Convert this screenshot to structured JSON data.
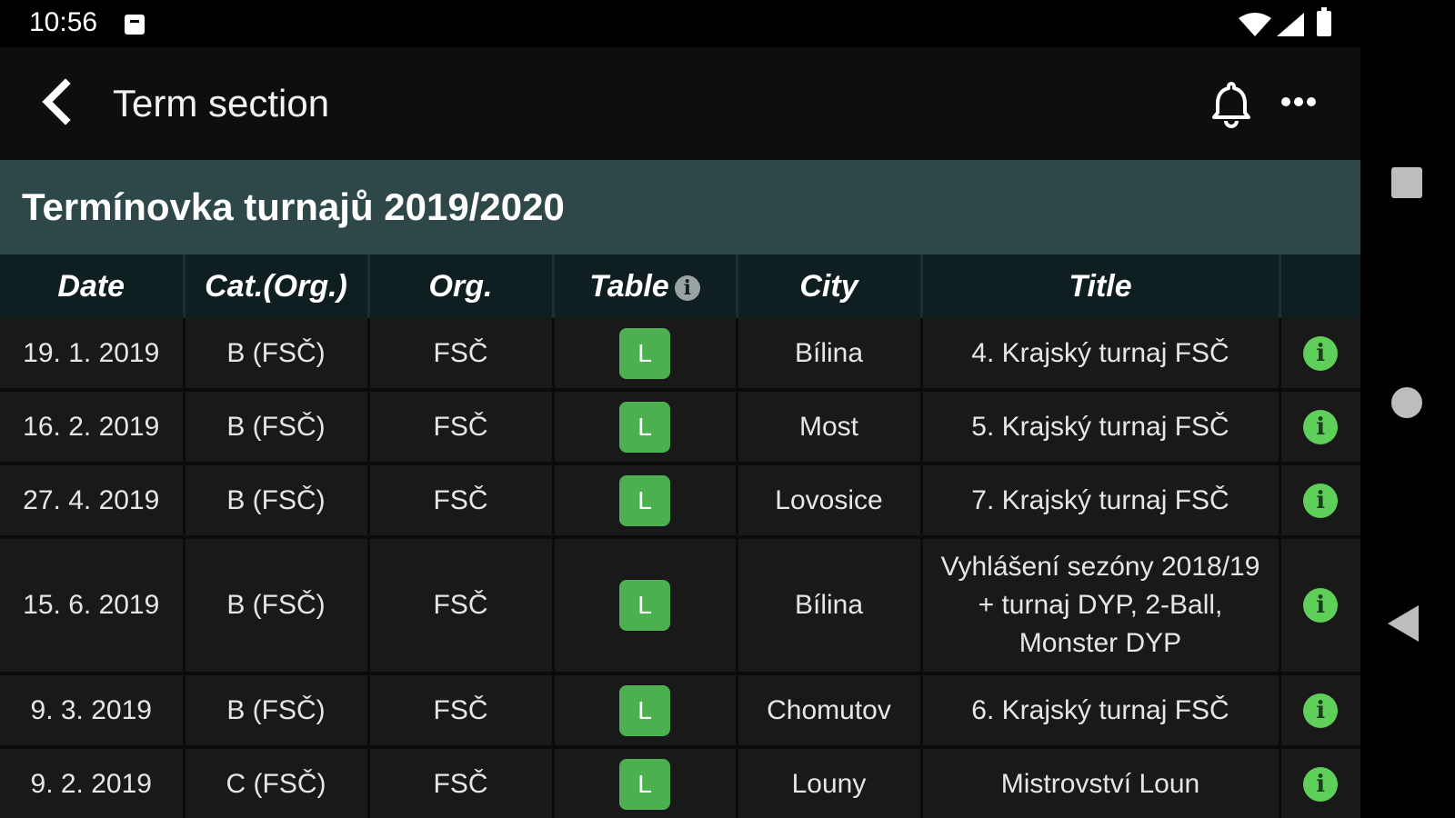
{
  "status_bar": {
    "time": "10:56",
    "icons": [
      "notification-a-icon",
      "wifi-icon",
      "signal-icon",
      "battery-icon"
    ]
  },
  "toolbar": {
    "back_icon": "chevron-left-icon",
    "title": "Term section",
    "bell_icon": "bell-icon",
    "more_icon": "more-horizontal-icon"
  },
  "section": {
    "title": "Termínovka turnajů 2019/2020"
  },
  "table": {
    "columns": {
      "date": "Date",
      "cat": "Cat.(Org.)",
      "org": "Org.",
      "table": "Table",
      "city": "City",
      "title": "Title",
      "info": ""
    },
    "rows": [
      {
        "date": "19. 1. 2019",
        "cat": "B (FSČ)",
        "org": "FSČ",
        "table": "L",
        "city": "Bílina",
        "title": "4. Krajský turnaj FSČ"
      },
      {
        "date": "16. 2. 2019",
        "cat": "B (FSČ)",
        "org": "FSČ",
        "table": "L",
        "city": "Most",
        "title": "5. Krajský turnaj FSČ"
      },
      {
        "date": "27. 4. 2019",
        "cat": "B (FSČ)",
        "org": "FSČ",
        "table": "L",
        "city": "Lovosice",
        "title": "7. Krajský turnaj FSČ"
      },
      {
        "date": "15. 6. 2019",
        "cat": "B (FSČ)",
        "org": "FSČ",
        "table": "L",
        "city": "Bílina",
        "title": "Vyhlášení sezóny 2018/19 + turnaj DYP, 2-Ball, Monster DYP"
      },
      {
        "date": "9. 3. 2019",
        "cat": "B (FSČ)",
        "org": "FSČ",
        "table": "L",
        "city": "Chomutov",
        "title": "6. Krajský turnaj FSČ"
      },
      {
        "date": "9. 2. 2019",
        "cat": "C (FSČ)",
        "org": "FSČ",
        "table": "L",
        "city": "Louny",
        "title": "Mistrovství Loun"
      }
    ]
  },
  "nav_bar": {
    "icons": [
      "recents-square-icon",
      "home-circle-icon",
      "back-triangle-icon"
    ]
  },
  "colors": {
    "section_header": "#2e4749",
    "table_header": "#0f1e21",
    "badge": "#4caf50",
    "info": "#5ed05a"
  }
}
